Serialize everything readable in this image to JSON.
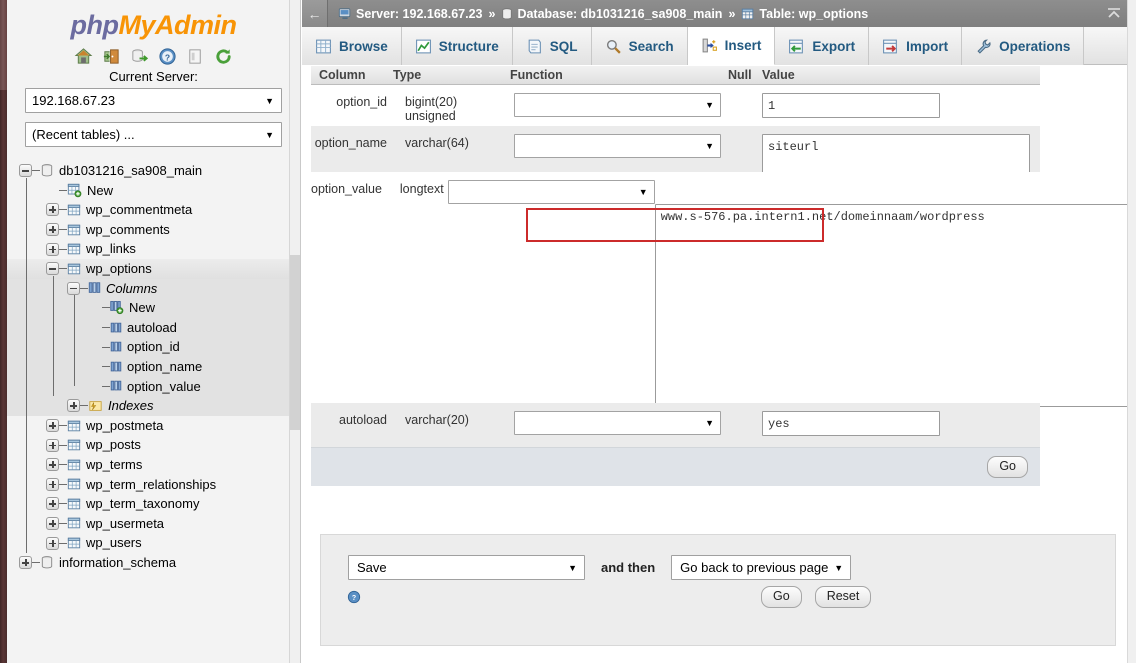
{
  "app": {
    "logo_php": "php",
    "logo_my": "MyAdmin",
    "current_server_label": "Current Server:",
    "server_select_value": "192.168.67.23",
    "recent_tables_value": "(Recent tables) ...",
    "toolbar_icons": [
      "home-icon",
      "logout-icon",
      "database-export-icon",
      "help-icon",
      "documentation-icon",
      "reload-icon"
    ]
  },
  "breadcrumb": {
    "back_arrow": "←",
    "server_label": "Server: 192.168.67.23",
    "sep": "»",
    "database_label": "Database: db1031216_sa908_main",
    "table_label": "Table: wp_options",
    "collapse_icon": "collapse-up-icon"
  },
  "tabs": [
    {
      "label": "Browse",
      "icon": "browse-icon",
      "active": false
    },
    {
      "label": "Structure",
      "icon": "structure-icon",
      "active": false
    },
    {
      "label": "SQL",
      "icon": "sql-icon",
      "active": false
    },
    {
      "label": "Search",
      "icon": "search-icon",
      "active": false
    },
    {
      "label": "Insert",
      "icon": "insert-icon",
      "active": true
    },
    {
      "label": "Export",
      "icon": "export-icon",
      "active": false
    },
    {
      "label": "Import",
      "icon": "import-icon",
      "active": false
    },
    {
      "label": "Operations",
      "icon": "operations-icon",
      "active": false
    }
  ],
  "tree": {
    "database": "db1031216_sa908_main",
    "items": [
      {
        "label": "New",
        "type": "new-table",
        "depth": 1
      },
      {
        "label": "wp_commentmeta",
        "type": "table",
        "depth": 1,
        "toggle": "plus"
      },
      {
        "label": "wp_comments",
        "type": "table",
        "depth": 1,
        "toggle": "plus"
      },
      {
        "label": "wp_links",
        "type": "table",
        "depth": 1,
        "toggle": "plus"
      },
      {
        "label": "wp_options",
        "type": "table",
        "depth": 1,
        "toggle": "minus",
        "selected": true
      },
      {
        "label": "Columns",
        "type": "columns",
        "depth": 2,
        "toggle": "minus",
        "italic": true
      },
      {
        "label": "New",
        "type": "new-column",
        "depth": 3
      },
      {
        "label": "autoload",
        "type": "column",
        "depth": 3
      },
      {
        "label": "option_id",
        "type": "column",
        "depth": 3
      },
      {
        "label": "option_name",
        "type": "column",
        "depth": 3
      },
      {
        "label": "option_value",
        "type": "column",
        "depth": 3
      },
      {
        "label": "Indexes",
        "type": "indexes",
        "depth": 2,
        "toggle": "plus",
        "italic": true
      },
      {
        "label": "wp_postmeta",
        "type": "table",
        "depth": 1,
        "toggle": "plus"
      },
      {
        "label": "wp_posts",
        "type": "table",
        "depth": 1,
        "toggle": "plus"
      },
      {
        "label": "wp_terms",
        "type": "table",
        "depth": 1,
        "toggle": "plus"
      },
      {
        "label": "wp_term_relationships",
        "type": "table",
        "depth": 1,
        "toggle": "plus"
      },
      {
        "label": "wp_term_taxonomy",
        "type": "table",
        "depth": 1,
        "toggle": "plus"
      },
      {
        "label": "wp_usermeta",
        "type": "table",
        "depth": 1,
        "toggle": "plus"
      },
      {
        "label": "wp_users",
        "type": "table",
        "depth": 1,
        "toggle": "plus"
      }
    ],
    "other_database": "information_schema"
  },
  "insert_form": {
    "headers": {
      "column": "Column",
      "type": "Type",
      "function": "Function",
      "null": "Null",
      "value": "Value"
    },
    "rows": [
      {
        "column": "option_id",
        "type": "bigint(20) unsigned",
        "function": "",
        "value": "1",
        "control": "input"
      },
      {
        "column": "option_name",
        "type": "varchar(64)",
        "function": "",
        "value": "siteurl",
        "control": "textarea-small"
      },
      {
        "column": "option_value",
        "type": "longtext",
        "function": "",
        "value": "www.s-576.pa.intern1.net/domeinnaam/wordpress",
        "control": "textarea-large",
        "highlighted": true
      },
      {
        "column": "autoload",
        "type": "varchar(20)",
        "function": "",
        "value": "yes",
        "control": "input"
      }
    ],
    "go_label": "Go"
  },
  "bottom_panel": {
    "save_value": "Save",
    "and_then_label": "and then",
    "then_value": "Go back to previous page",
    "go_label": "Go",
    "reset_label": "Reset",
    "help_icon": "help-icon"
  },
  "colors": {
    "accent_orange": "#f89406",
    "accent_purple": "#6c6ca0",
    "tab_link": "#235a81",
    "highlight_red": "#cc2b2b",
    "left_strip": "#4a2c2c"
  }
}
